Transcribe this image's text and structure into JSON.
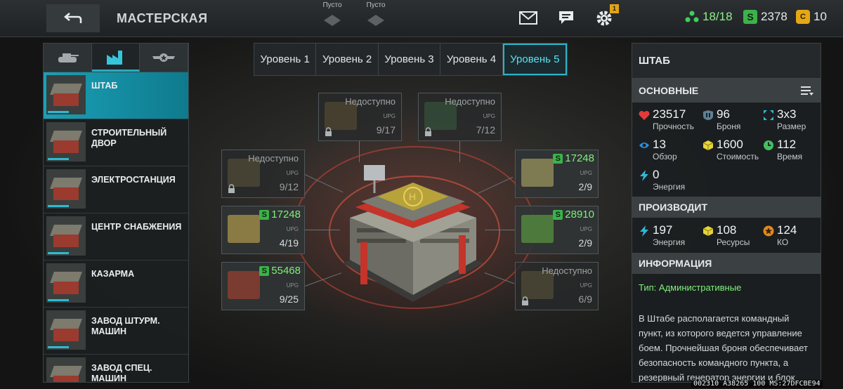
{
  "header": {
    "title": "МАСТЕРСКАЯ",
    "slots": [
      {
        "label": "Пусто"
      },
      {
        "label": "Пусто"
      }
    ],
    "settings_badge": "1",
    "resources": {
      "units": "18/18",
      "silver": "2378",
      "gold": "10"
    },
    "colors": {
      "units": "#3fd05a",
      "silver": "#3bb24a",
      "gold": "#e4a816"
    }
  },
  "left_panel": {
    "category_tabs": [
      {
        "icon": "tank-icon",
        "active": false
      },
      {
        "icon": "factory-icon",
        "active": true
      },
      {
        "icon": "wings-star-icon",
        "active": false
      }
    ],
    "buildings": [
      {
        "name": "Штаб",
        "selected": true
      },
      {
        "name": "Строительный двор",
        "selected": false
      },
      {
        "name": "Электростанция",
        "selected": false
      },
      {
        "name": "Центр снабжения",
        "selected": false
      },
      {
        "name": "Казарма",
        "selected": false
      },
      {
        "name": "Завод штурм. машин",
        "selected": false
      },
      {
        "name": "Завод спец. машин",
        "selected": false
      }
    ]
  },
  "level_tabs": [
    "Уровень 1",
    "Уровень 2",
    "Уровень 3",
    "Уровень 4",
    "Уровень 5"
  ],
  "active_level": 5,
  "upgrades": [
    {
      "status": "Недоступно",
      "label": "UPG",
      "progress": "9/17",
      "locked": true
    },
    {
      "status": "Недоступно",
      "label": "UPG",
      "progress": "7/12",
      "locked": true
    },
    {
      "status": "Недоступно",
      "label": "UPG",
      "progress": "9/12",
      "locked": true
    },
    {
      "price": "17248",
      "label": "UPG",
      "progress": "2/9",
      "locked": false
    },
    {
      "price": "17248",
      "label": "UPG",
      "progress": "4/19",
      "locked": false
    },
    {
      "price": "28910",
      "label": "UPG",
      "progress": "2/9",
      "locked": false
    },
    {
      "price": "55468",
      "label": "UPG",
      "progress": "9/25",
      "locked": false
    },
    {
      "status": "Недоступно",
      "label": "UPG",
      "progress": "6/9",
      "locked": true
    }
  ],
  "right_panel": {
    "title": "ШТАБ",
    "basic": {
      "heading": "ОСНОВНЫЕ",
      "stats": [
        {
          "icon": "heart-icon",
          "value": "23517",
          "label": "Прочность"
        },
        {
          "icon": "armor-icon",
          "value": "96",
          "label": "Броня"
        },
        {
          "icon": "size-icon",
          "value": "3x3",
          "label": "Размер"
        },
        {
          "icon": "eye-icon",
          "value": "13",
          "label": "Обзор"
        },
        {
          "icon": "cube-icon",
          "value": "1600",
          "label": "Стоимость"
        },
        {
          "icon": "clock-icon",
          "value": "112",
          "label": "Время"
        },
        {
          "icon": "lightning-icon",
          "value": "0",
          "label": "Энергия"
        }
      ]
    },
    "produces": {
      "heading": "ПРОИЗВОДИТ",
      "stats": [
        {
          "icon": "lightning-icon",
          "value": "197",
          "label": "Энергия"
        },
        {
          "icon": "cube-icon",
          "value": "108",
          "label": "Ресурсы"
        },
        {
          "icon": "star-coin-icon",
          "value": "124",
          "label": "КО"
        }
      ]
    },
    "info": {
      "heading": "ИНФОРМАЦИЯ",
      "type_line": "Тип: Административные",
      "description": "В Штабе располагается командный пункт, из которого ведется управление боем. Прочнейшая броня обеспечивает безопасность командного пункта, а резервный генератор энергии и блок"
    }
  },
  "footer_code": "002310 A38265 100 MS:27DFCBE94"
}
